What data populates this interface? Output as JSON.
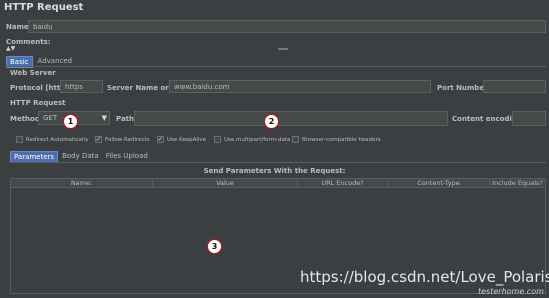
{
  "panel": {
    "title": "HTTP Request",
    "name_label": "Name:",
    "name_value": "baidu",
    "comments_label": "Comments:"
  },
  "tabs": [
    {
      "label": "Basic",
      "active": true
    },
    {
      "label": "Advanced",
      "active": false
    }
  ],
  "web_server": {
    "section_label": "Web Server",
    "protocol_label": "Protocol [http]:",
    "protocol_value": "https",
    "server_label": "Server Name or IP:",
    "server_value": "www.baidu.com",
    "port_label": "Port Number:",
    "port_value": ""
  },
  "http_request": {
    "section_label": "HTTP Request",
    "method_label": "Method:",
    "method_value": "GET",
    "path_label": "Path:",
    "path_value": "",
    "encoding_label": "Content encoding:",
    "encoding_value": ""
  },
  "options": [
    {
      "label": "Redirect Automatically",
      "checked": false
    },
    {
      "label": "Follow Redirects",
      "checked": true
    },
    {
      "label": "Use KeepAlive",
      "checked": true
    },
    {
      "label": "Use multipart/form-data",
      "checked": false
    },
    {
      "label": "Browser-compatible headers",
      "checked": false
    }
  ],
  "sub_tabs": [
    {
      "label": "Parameters",
      "active": true
    },
    {
      "label": "Body Data",
      "active": false
    },
    {
      "label": "Files Upload",
      "active": false
    }
  ],
  "params": {
    "heading": "Send Parameters With the Request:",
    "columns": [
      "Name:",
      "Value",
      "URL Encode?",
      "Content-Type",
      "Include Equals?"
    ]
  },
  "annotations": [
    "1",
    "2",
    "3"
  ],
  "watermark": {
    "url": "https://blog.csdn.net/Love_Polaris",
    "logo": "testerhome.com"
  },
  "colors": {
    "background": "#3c3f41",
    "field": "#45494a",
    "active_tab": "#4b6eaf",
    "badge_border": "#d01010"
  }
}
